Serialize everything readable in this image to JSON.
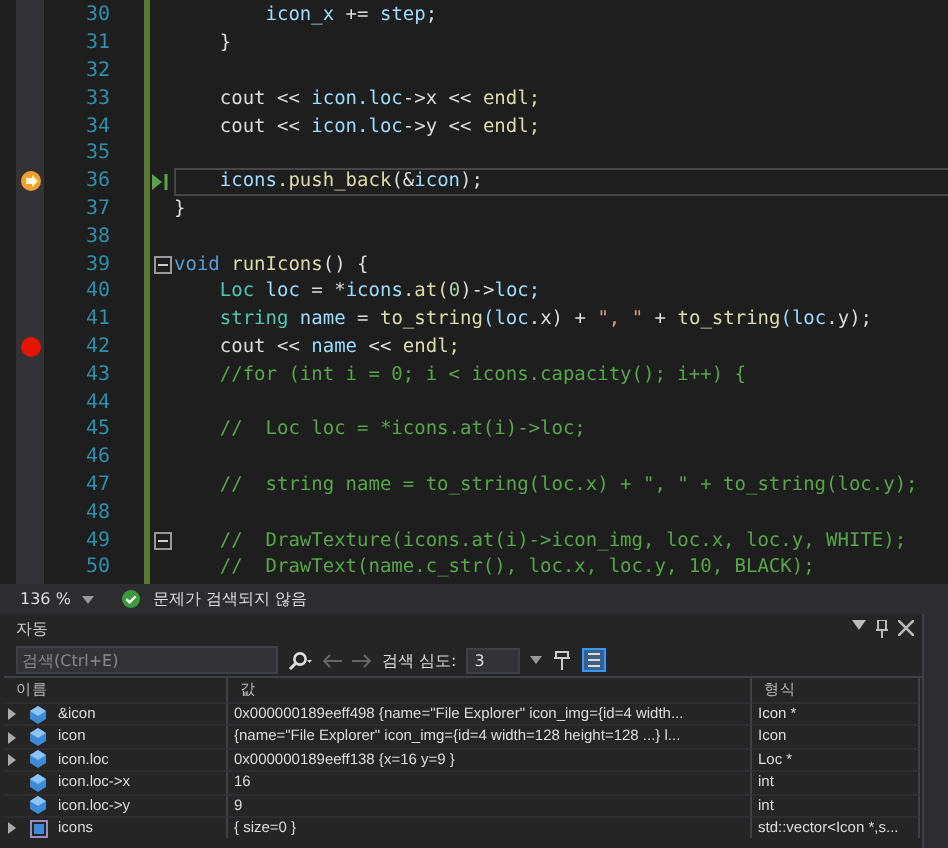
{
  "editor": {
    "lines": [
      {
        "number": "30",
        "breakpoint": false,
        "current": false,
        "fold": false,
        "tokens": [
          {
            "text": "        icon_x",
            "kind": "var"
          },
          {
            "text": " += ",
            "kind": "plain"
          },
          {
            "text": "step",
            "kind": "var"
          },
          {
            "text": ";",
            "kind": "plain"
          }
        ]
      },
      {
        "number": "31",
        "breakpoint": false,
        "current": false,
        "fold": false,
        "tokens": [
          {
            "text": "    }",
            "kind": "plain"
          }
        ]
      },
      {
        "number": "32",
        "breakpoint": false,
        "current": false,
        "fold": false
      },
      {
        "number": "33",
        "breakpoint": false,
        "current": false,
        "fold": false,
        "tokens": [
          {
            "text": "    cout << ",
            "kind": "plain"
          },
          {
            "text": "icon.loc",
            "kind": "var"
          },
          {
            "text": "->x << ",
            "kind": "plain"
          },
          {
            "text": "endl;",
            "kind": "func"
          }
        ]
      },
      {
        "number": "34",
        "breakpoint": false,
        "current": false,
        "fold": false,
        "tokens": [
          {
            "text": "    cout << ",
            "kind": "plain"
          },
          {
            "text": "icon.loc",
            "kind": "var"
          },
          {
            "text": "->y << ",
            "kind": "plain"
          },
          {
            "text": "endl;",
            "kind": "func"
          }
        ]
      },
      {
        "number": "35",
        "breakpoint": false,
        "current": false,
        "fold": false
      },
      {
        "number": "36",
        "breakpoint": true,
        "current": true,
        "fold": false,
        "tokens": [
          {
            "text": "    icons",
            "kind": "var"
          },
          {
            "text": ".push_back",
            "kind": "func"
          },
          {
            "text": "(&",
            "kind": "plain"
          },
          {
            "text": "icon",
            "kind": "var"
          },
          {
            "text": ");",
            "kind": "plain"
          }
        ]
      },
      {
        "number": "37",
        "breakpoint": false,
        "current": false,
        "fold": false,
        "tokens": [
          {
            "text": "}",
            "kind": "plain"
          }
        ]
      },
      {
        "number": "38",
        "breakpoint": false,
        "current": false,
        "fold": false
      },
      {
        "number": "39",
        "breakpoint": false,
        "current": false,
        "fold": true,
        "tokens": [
          {
            "text": "void ",
            "kind": "keyword"
          },
          {
            "text": "runIcons",
            "kind": "func"
          },
          {
            "text": "() {",
            "kind": "plain"
          }
        ]
      },
      {
        "number": "40",
        "breakpoint": false,
        "current": false,
        "fold": false,
        "tokens": [
          {
            "text": "    Loc",
            "kind": "type"
          },
          {
            "text": " loc",
            "kind": "var"
          },
          {
            "text": " = *",
            "kind": "plain"
          },
          {
            "text": "icons",
            "kind": "var"
          },
          {
            "text": ".at(",
            "kind": "func"
          },
          {
            "text": "0",
            "kind": "number"
          },
          {
            "text": ")->",
            "kind": "plain"
          },
          {
            "text": "loc;",
            "kind": "var"
          }
        ]
      },
      {
        "number": "41",
        "breakpoint": false,
        "current": false,
        "fold": false,
        "tokens": [
          {
            "text": "    string",
            "kind": "type"
          },
          {
            "text": " name",
            "kind": "var"
          },
          {
            "text": " = ",
            "kind": "plain"
          },
          {
            "text": "to_string",
            "kind": "func"
          },
          {
            "text": "(loc",
            "kind": "var"
          },
          {
            "text": ".x) + ",
            "kind": "plain"
          },
          {
            "text": "\", \"",
            "kind": "string"
          },
          {
            "text": " + ",
            "kind": "plain"
          },
          {
            "text": "to_string",
            "kind": "func"
          },
          {
            "text": "(loc",
            "kind": "var"
          },
          {
            "text": ".y);",
            "kind": "plain"
          }
        ]
      },
      {
        "number": "42",
        "breakpoint": true,
        "current": false,
        "fold": false,
        "tokens": [
          {
            "text": "    cout << ",
            "kind": "plain"
          },
          {
            "text": "name",
            "kind": "var"
          },
          {
            "text": " << ",
            "kind": "plain"
          },
          {
            "text": "endl;",
            "kind": "func"
          }
        ]
      },
      {
        "number": "43",
        "breakpoint": false,
        "current": false,
        "fold": false,
        "tokens": [
          {
            "text": "    //for (int i = 0; i < icons.capacity(); i++) {",
            "kind": "comment"
          }
        ]
      },
      {
        "number": "44",
        "breakpoint": false,
        "current": false,
        "fold": false
      },
      {
        "number": "45",
        "breakpoint": false,
        "current": false,
        "fold": false,
        "tokens": [
          {
            "text": "    //  Loc loc = *icons.at(i)->loc;",
            "kind": "comment"
          }
        ]
      },
      {
        "number": "46",
        "breakpoint": false,
        "current": false,
        "fold": false
      },
      {
        "number": "47",
        "breakpoint": false,
        "current": false,
        "fold": false,
        "tokens": [
          {
            "text": "    //  string name = to_string(loc.x) + \", \" + to_string(loc.y);",
            "kind": "comment"
          }
        ]
      },
      {
        "number": "48",
        "breakpoint": false,
        "current": false,
        "fold": false
      },
      {
        "number": "49",
        "breakpoint": false,
        "current": false,
        "fold": true,
        "tokens": [
          {
            "text": "    //  DrawTexture(icons.at(i)->icon_img, loc.x, loc.y, WHITE);",
            "kind": "comment"
          }
        ]
      },
      {
        "number": "50",
        "breakpoint": false,
        "current": false,
        "fold": false,
        "tokens": [
          {
            "text": "    //  DrawText(name.c_str(), loc.x, loc.y, 10, BLACK);",
            "kind": "comment"
          }
        ]
      }
    ]
  },
  "status_bar": {
    "zoom": "136 %",
    "message": "문제가 검색되지 않음"
  },
  "autos_panel": {
    "title": "자동",
    "search": {
      "placeholder": "검색(Ctrl+E)"
    },
    "depth_label": "검색 심도:",
    "depth": "3",
    "columns": [
      "이름",
      "값",
      "형식"
    ],
    "rows": [
      {
        "name": "&icon",
        "value": "0x000000189eeff498 {name=\"File Explorer\" icon_img={id=4 width...",
        "type": "Icon *",
        "expandable": true,
        "kind": "field"
      },
      {
        "name": "icon",
        "value": "{name=\"File Explorer\" icon_img={id=4 width=128 height=128 ...} l...",
        "type": "Icon",
        "expandable": true,
        "kind": "field"
      },
      {
        "name": "icon.loc",
        "value": "0x000000189eeff138 {x=16 y=9 }",
        "type": "Loc *",
        "expandable": true,
        "kind": "field"
      },
      {
        "name": "icon.loc->x",
        "value": "16",
        "type": "int",
        "expandable": false,
        "kind": "field"
      },
      {
        "name": "icon.loc->y",
        "value": "9",
        "type": "int",
        "expandable": false,
        "kind": "field"
      },
      {
        "name": "icons",
        "value": "{ size=0 }",
        "type": "std::vector<Icon *,s...",
        "expandable": true,
        "kind": "vector"
      }
    ]
  }
}
